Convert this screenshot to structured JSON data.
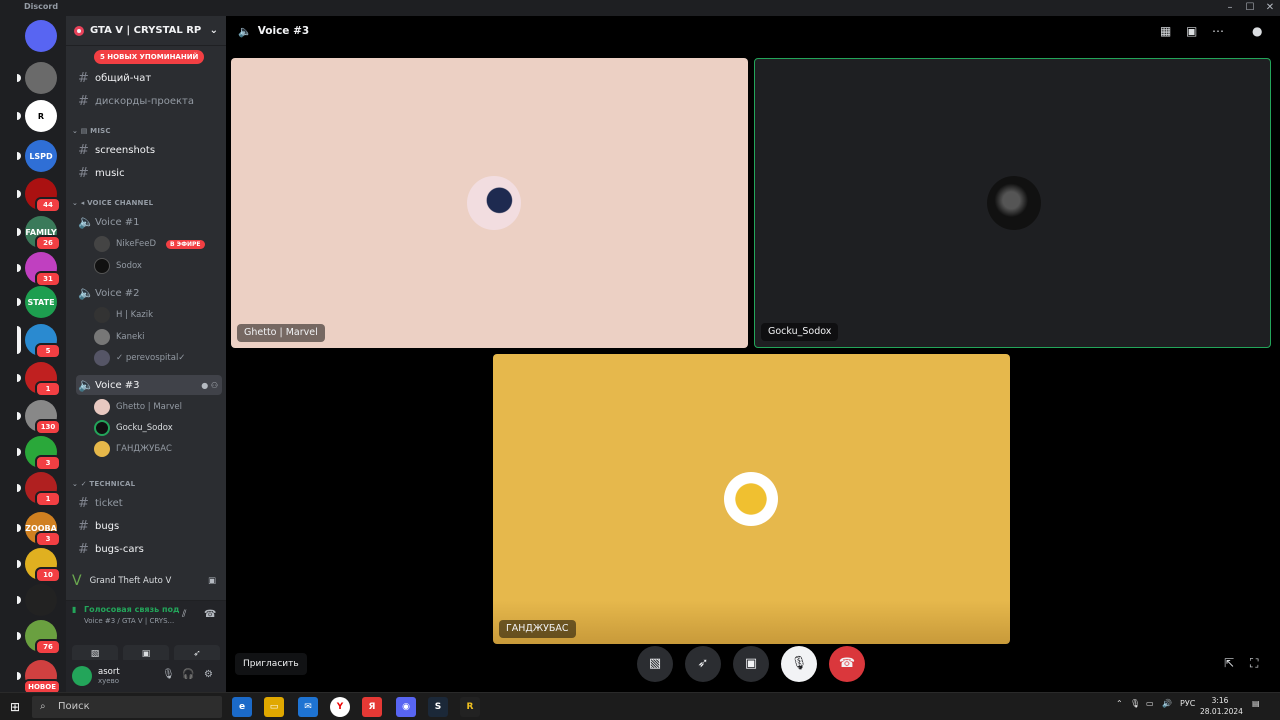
{
  "window": {
    "title": "Discord"
  },
  "servers": [
    {
      "icon": "discord-home-icon",
      "color": "#5865f2",
      "label": "",
      "badge": ""
    },
    {
      "icon": "server-icon",
      "color": "#6a6a6a",
      "label": "",
      "badge": ""
    },
    {
      "icon": "server-icon",
      "color": "#ffffff",
      "label": "R",
      "badge": ""
    },
    {
      "icon": "server-icon",
      "color": "#2f6fd6",
      "label": "LSPD",
      "badge": ""
    },
    {
      "icon": "server-icon",
      "color": "#a11",
      "label": "",
      "badge": "44"
    },
    {
      "icon": "server-icon",
      "color": "#3a7a5a",
      "label": "FAMILY",
      "badge": "26"
    },
    {
      "icon": "server-icon",
      "color": "#c040c0",
      "label": "",
      "badge": "31"
    },
    {
      "icon": "server-icon",
      "color": "#1d9e4f",
      "label": "STATE",
      "badge": ""
    },
    {
      "icon": "server-icon",
      "color": "#2a8ad0",
      "label": "",
      "badge": "5"
    },
    {
      "icon": "server-icon",
      "color": "#c02020",
      "label": "",
      "badge": "1"
    },
    {
      "icon": "server-icon",
      "color": "#888888",
      "label": "",
      "badge": "130"
    },
    {
      "icon": "server-icon",
      "color": "#2aa83a",
      "label": "",
      "badge": "3"
    },
    {
      "icon": "server-icon",
      "color": "#b02020",
      "label": "",
      "badge": "1"
    },
    {
      "icon": "server-icon",
      "color": "#d08020",
      "label": "ZOOBA",
      "badge": "3"
    },
    {
      "icon": "server-icon",
      "color": "#e0b020",
      "label": "",
      "badge": "10"
    },
    {
      "icon": "server-icon",
      "color": "#222222",
      "label": "",
      "badge": ""
    },
    {
      "icon": "server-icon",
      "color": "#6aa040",
      "label": "",
      "badge": "76"
    },
    {
      "icon": "server-icon",
      "color": "#d04040",
      "label": "",
      "badge": "НОВОЕ"
    }
  ],
  "sidebar": {
    "server_name": "GTA V | CRYSTAL RP",
    "mentions_pill": "5 НОВЫХ УПОМИНАНИЙ",
    "channels_top": [
      {
        "name": "общий-чат",
        "bright": true
      },
      {
        "name": "дискорды-проекта",
        "bright": false
      }
    ],
    "cat_misc": "MISC",
    "channels_misc": [
      {
        "name": "screenshots",
        "bright": true
      },
      {
        "name": "music",
        "bright": true
      }
    ],
    "cat_voice": "VOICE CHANNEL",
    "voice1": "Voice #1",
    "voice1_users": [
      {
        "name": "NikeFeeD",
        "live": "В ЭФИРЕ",
        "color": "#444"
      },
      {
        "name": "Sodox",
        "live": "",
        "color": "#111"
      }
    ],
    "voice2": "Voice #2",
    "voice2_users": [
      {
        "name": "H | Kazik",
        "color": "#333"
      },
      {
        "name": "Kaneki",
        "color": "#777"
      },
      {
        "name": "✓ perevospital✓",
        "color": "#556"
      }
    ],
    "voice3": "Voice #3",
    "voice3_users": [
      {
        "name": "Ghetto | Marvel",
        "color": "#e8c8c0",
        "on": false
      },
      {
        "name": "Gocku_Sodox",
        "color": "#111",
        "on": true
      },
      {
        "name": "ГАНДЖУБАС",
        "color": "#e6b84a",
        "on": false
      }
    ],
    "cat_tech": "TECHNICAL",
    "channels_tech": [
      {
        "name": "ticket",
        "bright": false
      },
      {
        "name": "bugs",
        "bright": true
      },
      {
        "name": "bugs-cars",
        "bright": true
      }
    ],
    "activity": "Grand Theft Auto V",
    "voice_status": "Голосовая связь под",
    "voice_sub": "Voice #3 / GTA V | CRYS...",
    "user_name": "asort",
    "user_status": "хуево"
  },
  "main": {
    "channel": "Voice #3",
    "invite": "Пригласить",
    "tiles": [
      {
        "name": "Ghetto | Marvel",
        "bg": "#ecd0c4"
      },
      {
        "name": "Gocku_Sodox",
        "bg": "#1e1f22"
      },
      {
        "name": "ГАНДЖУБАС",
        "bg": "#e6b84c"
      }
    ]
  },
  "taskbar": {
    "search": "Поиск",
    "lang": "РУС",
    "time": "3:16",
    "date": "28.01.2024"
  }
}
